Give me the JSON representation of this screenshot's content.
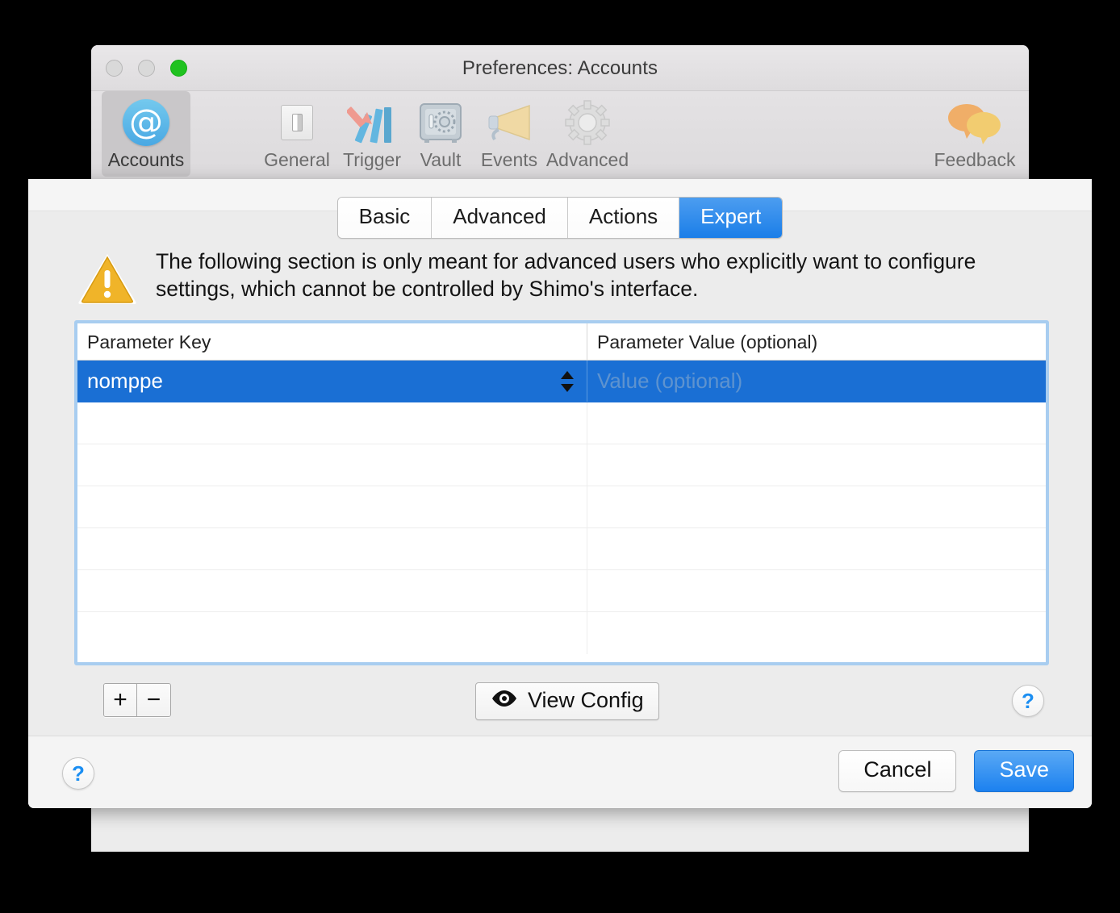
{
  "window": {
    "title": "Preferences: Accounts",
    "traffic_lights": [
      "close-button",
      "minimize-button",
      "zoom-button"
    ]
  },
  "toolbar": {
    "items": [
      {
        "label": "Accounts",
        "icon": "at-sign-icon",
        "selected": true
      },
      {
        "label": "General",
        "icon": "switch-icon",
        "selected": false
      },
      {
        "label": "Trigger",
        "icon": "trigger-bars-icon",
        "selected": false
      },
      {
        "label": "Vault",
        "icon": "safe-icon",
        "selected": false
      },
      {
        "label": "Events",
        "icon": "megaphone-icon",
        "selected": false
      },
      {
        "label": "Advanced",
        "icon": "gear-icon",
        "selected": false
      },
      {
        "label": "Feedback",
        "icon": "speech-bubbles-icon",
        "selected": false
      }
    ]
  },
  "sheet": {
    "tabs": [
      {
        "label": "Basic",
        "active": false
      },
      {
        "label": "Advanced",
        "active": false
      },
      {
        "label": "Actions",
        "active": false
      },
      {
        "label": "Expert",
        "active": true
      }
    ],
    "warning": {
      "icon": "warning-triangle-icon",
      "text": "The following section is only meant for advanced users who explicitly want to configure settings, which cannot be controlled by Shimo's interface."
    },
    "table": {
      "columns": [
        "Parameter Key",
        "Parameter Value (optional)"
      ],
      "rows": [
        {
          "key": "nomppe",
          "value": "",
          "value_placeholder": "Value (optional)",
          "selected": true,
          "has_stepper": true
        },
        {
          "key": "",
          "value": "",
          "selected": false
        },
        {
          "key": "",
          "value": "",
          "selected": false
        },
        {
          "key": "",
          "value": "",
          "selected": false
        },
        {
          "key": "",
          "value": "",
          "selected": false
        },
        {
          "key": "",
          "value": "",
          "selected": false
        },
        {
          "key": "",
          "value": "",
          "selected": false
        }
      ]
    },
    "controls": {
      "add_label": "+",
      "remove_label": "−",
      "view_config_label": "View Config",
      "view_config_icon": "eye-icon",
      "help_label": "?"
    }
  },
  "footer": {
    "help_label": "?",
    "cancel_label": "Cancel",
    "save_label": "Save"
  },
  "colors": {
    "accent_blue": "#1a6fd4",
    "tab_active_blue": "#1b7ee8",
    "focus_ring": "#a8cdf0",
    "warning_yellow": "#f0b429",
    "help_blue": "#1b8ef2"
  }
}
